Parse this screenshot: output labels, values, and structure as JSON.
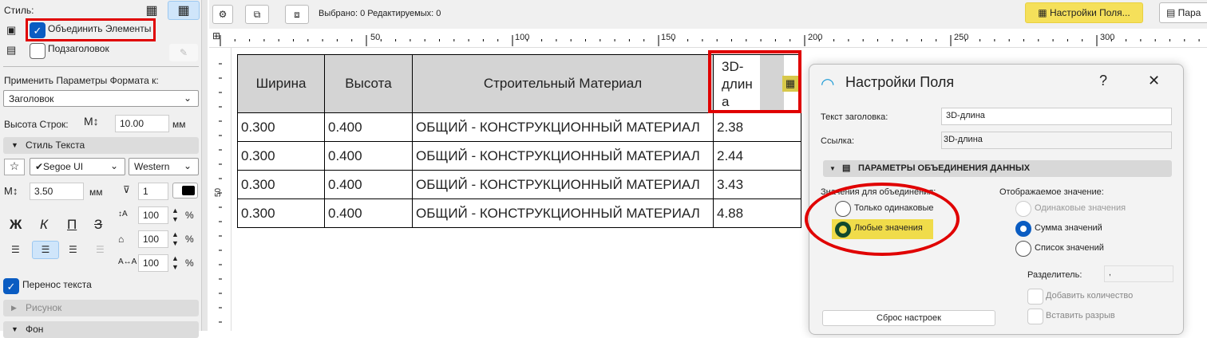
{
  "left": {
    "style_label": "Стиль:",
    "merge_elements": {
      "label": "Объединить Элементы",
      "checked": true
    },
    "subheader": {
      "label": "Подзаголовок",
      "checked": false
    },
    "apply_format_label": "Применить Параметры Формата к:",
    "apply_format_value": "Заголовок",
    "row_height_label": "Высота Строк:",
    "row_height_value": "10.00",
    "unit_mm": "мм",
    "text_style_section": "Стиль Текста",
    "font_value": "✔Segoe UI",
    "script_value": "Western",
    "text_size_value": "3.50",
    "pen_value": "1",
    "bold": "Ж",
    "italic": "К",
    "underline": "П",
    "strike": "З",
    "spacing1": "100",
    "spacing2": "100",
    "spacing3": "100",
    "percent": "%",
    "wrap_text": {
      "label": "Перенос текста",
      "checked": true
    },
    "picture_section": "Рисунок",
    "background_section": "Фон"
  },
  "toolbar": {
    "status": "Выбрано: 0  Редактируемых: 0",
    "field_settings_button": "Настройки Поля...",
    "params_button": "Пара"
  },
  "ruler": {
    "labels": [
      "50",
      "100",
      "150",
      "200",
      "250",
      "300"
    ],
    "vertical_label": "50"
  },
  "table": {
    "headers": [
      "Ширина",
      "Высота",
      "Строительный Материал",
      "3D-\nдлин\nа"
    ],
    "rows": [
      [
        "0.300",
        "0.400",
        "ОБЩИЙ - КОНСТРУКЦИОННЫЙ МАТЕРИАЛ",
        "2.38"
      ],
      [
        "0.300",
        "0.400",
        "ОБЩИЙ - КОНСТРУКЦИОННЫЙ МАТЕРИАЛ",
        "2.44"
      ],
      [
        "0.300",
        "0.400",
        "ОБЩИЙ - КОНСТРУКЦИОННЫЙ МАТЕРИАЛ",
        "3.43"
      ],
      [
        "0.300",
        "0.400",
        "ОБЩИЙ - КОНСТРУКЦИОННЫЙ МАТЕРИАЛ",
        "4.88"
      ]
    ]
  },
  "dialog": {
    "title": "Настройки Поля",
    "help": "?",
    "close": "✕",
    "header_text_label": "Текст заголовка:",
    "header_text_value": "3D-длина",
    "link_label": "Ссылка:",
    "link_value": "3D-длина",
    "section": "ПАРАМЕТРЫ ОБЪЕДИНЕНИЯ ДАННЫХ",
    "merge_values_label": "Значения для объединения:",
    "only_same": "Только одинаковые",
    "any_values": "Любые значения",
    "display_label": "Отображаемое значение:",
    "same_values": "Одинаковые значения",
    "sum_values": "Сумма значений",
    "list_values": "Список значений",
    "separator_label": "Разделитель:",
    "separator_value": ",",
    "add_count": "Добавить количество",
    "insert_break": "Вставить разрыв",
    "reset_button": "Сброс настроек"
  },
  "colors": {
    "accent": "#0a5cc2",
    "highlight": "#f5e05a",
    "annotation": "#e00000"
  }
}
